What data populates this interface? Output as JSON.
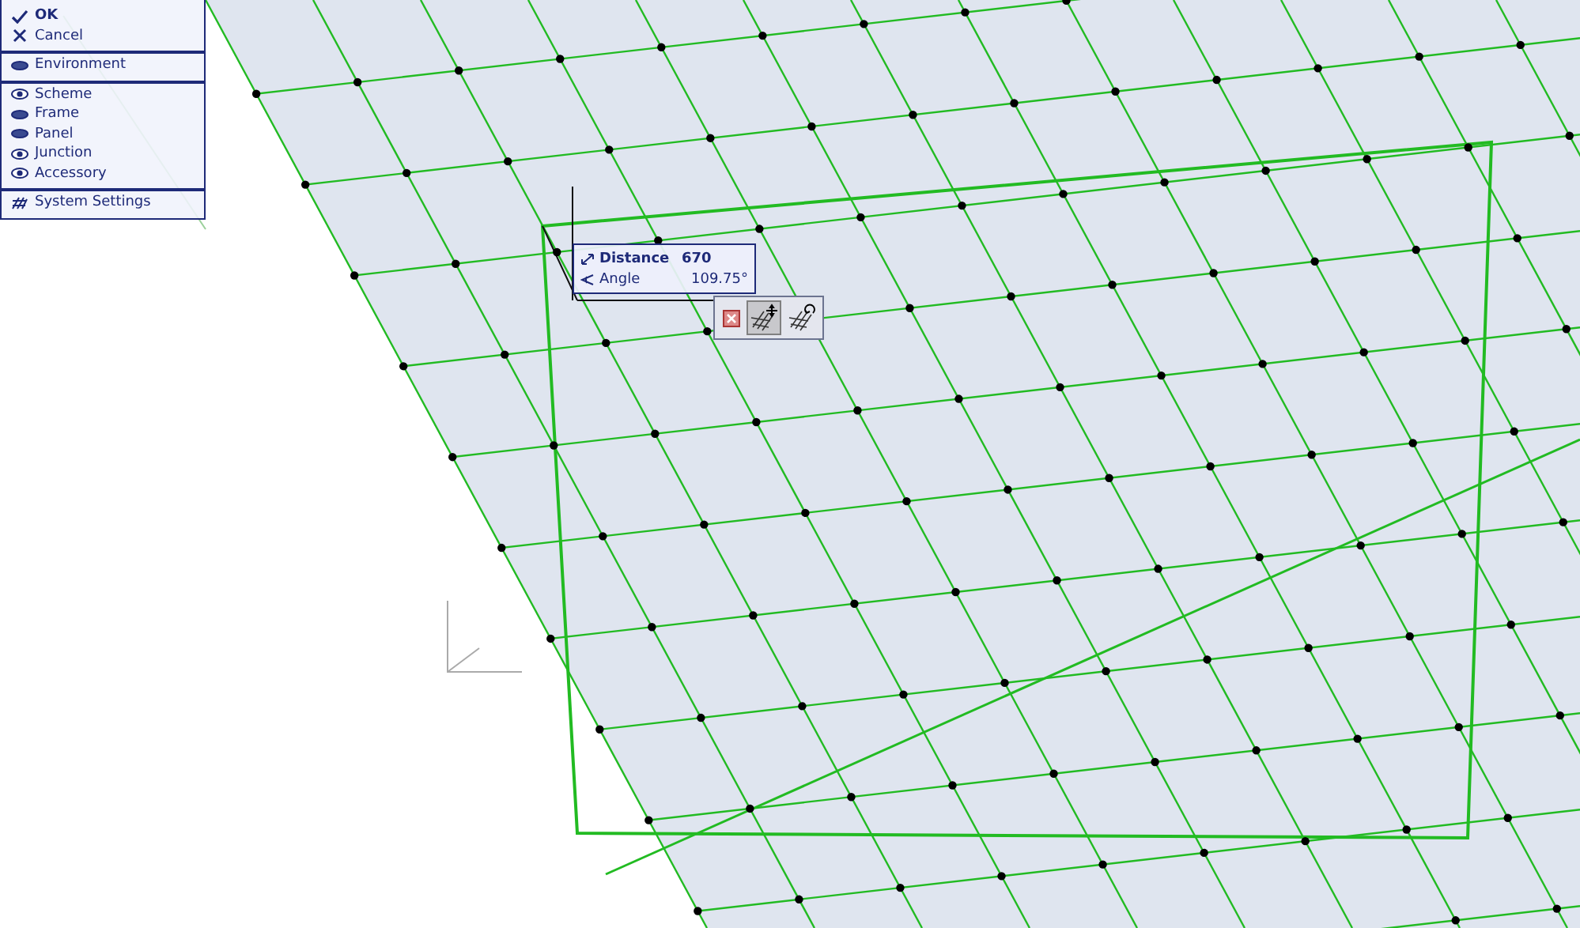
{
  "menu": {
    "sections": [
      [
        {
          "kind": "ok",
          "label": "OK"
        },
        {
          "kind": "cancel",
          "label": "Cancel"
        }
      ],
      [
        {
          "kind": "visibility",
          "label": "Environment",
          "visible": false
        }
      ],
      [
        {
          "kind": "visibility",
          "label": "Scheme",
          "visible": true
        },
        {
          "kind": "visibility",
          "label": "Frame",
          "visible": false
        },
        {
          "kind": "visibility",
          "label": "Panel",
          "visible": false
        },
        {
          "kind": "visibility",
          "label": "Junction",
          "visible": true
        },
        {
          "kind": "visibility",
          "label": "Accessory",
          "visible": true
        }
      ],
      [
        {
          "kind": "settings",
          "label": "System Settings"
        }
      ]
    ]
  },
  "tracker": {
    "rows": [
      {
        "kind": "distance",
        "label": "Distance",
        "value": "670"
      },
      {
        "kind": "angle",
        "label": "Angle",
        "value": "109.75°"
      }
    ]
  },
  "pet_palette": {
    "buttons": [
      {
        "kind": "cancel",
        "selected": false
      },
      {
        "kind": "move",
        "selected": true
      },
      {
        "kind": "rotate",
        "selected": false
      }
    ]
  }
}
